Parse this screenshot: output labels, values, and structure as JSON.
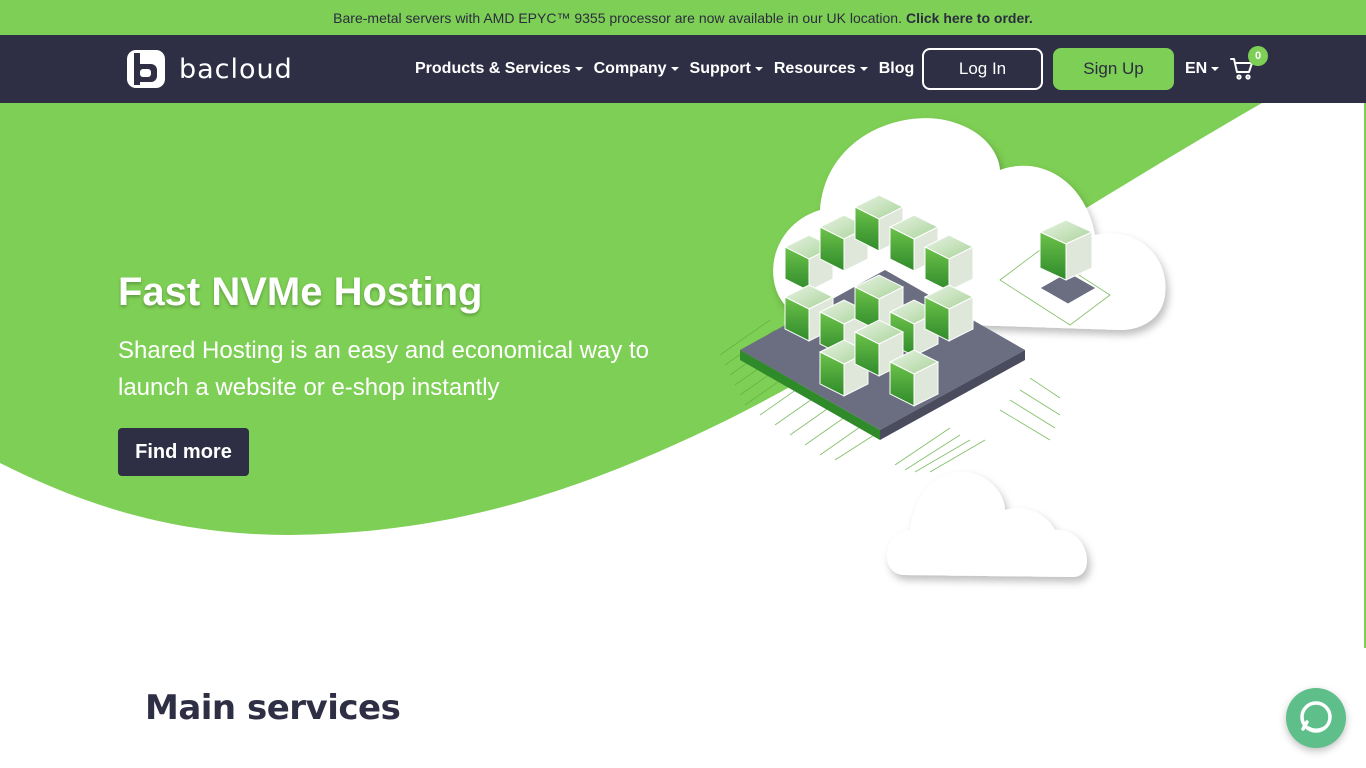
{
  "announcement": {
    "text": "Bare-metal servers with AMD EPYC™ 9355 processor are now available in our UK location.",
    "link": "Click here to order."
  },
  "nav": {
    "logo_text": "bacloud",
    "items": [
      {
        "label": "Products & Services",
        "dropdown": true
      },
      {
        "label": "Company",
        "dropdown": true
      },
      {
        "label": "Support",
        "dropdown": true
      },
      {
        "label": "Resources",
        "dropdown": true
      },
      {
        "label": "Blog",
        "dropdown": false
      }
    ],
    "login_label": "Log In",
    "signup_label": "Sign Up",
    "language": "EN",
    "cart_count": "0"
  },
  "hero": {
    "title": "Fast NVMe Hosting",
    "subtitle": "Shared Hosting is an easy and economical way to launch a website or e-shop instantly",
    "button_label": "Find more"
  },
  "services": {
    "title": "Main services"
  },
  "colors": {
    "brand_green": "#7ecf55",
    "navy": "#2e2f44",
    "chat": "#5fbf8a"
  },
  "icons": {
    "cart": "shopping-cart-icon",
    "chat": "chat-bubble-icon",
    "logo": "bacloud-logo-icon"
  }
}
